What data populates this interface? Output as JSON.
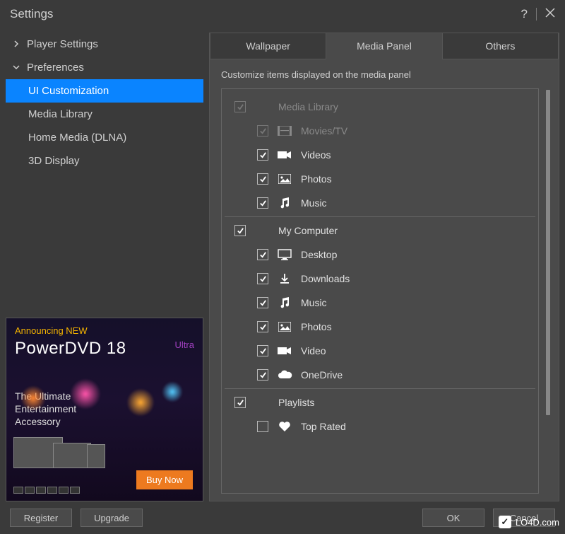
{
  "title": "Settings",
  "sidebar": {
    "groups": [
      {
        "label": "Player Settings",
        "expanded": false
      },
      {
        "label": "Preferences",
        "expanded": true
      }
    ],
    "items": [
      {
        "label": "UI Customization",
        "selected": true
      },
      {
        "label": "Media Library"
      },
      {
        "label": "Home Media (DLNA)"
      },
      {
        "label": "3D Display"
      }
    ]
  },
  "ad": {
    "announcing": "Announcing NEW",
    "ultra": "Ultra",
    "product": "PowerDVD 18",
    "tagline": "The Ultimate Entertainment Accessory",
    "buy": "Buy Now"
  },
  "tabs": [
    {
      "label": "Wallpaper"
    },
    {
      "label": "Media Panel",
      "active": true
    },
    {
      "label": "Others"
    }
  ],
  "panel": {
    "desc": "Customize items displayed on the media panel"
  },
  "tree": {
    "media_library": {
      "label": "Media Library",
      "checked": true,
      "disabled": true
    },
    "movies_tv": {
      "label": "Movies/TV",
      "checked": true,
      "disabled": true
    },
    "videos": {
      "label": "Videos",
      "checked": true
    },
    "photos": {
      "label": "Photos",
      "checked": true
    },
    "music": {
      "label": "Music",
      "checked": true
    },
    "my_computer": {
      "label": "My Computer",
      "checked": true
    },
    "desktop": {
      "label": "Desktop",
      "checked": true
    },
    "downloads": {
      "label": "Downloads",
      "checked": true
    },
    "mc_music": {
      "label": "Music",
      "checked": true
    },
    "mc_photos": {
      "label": "Photos",
      "checked": true
    },
    "mc_video": {
      "label": "Video",
      "checked": true
    },
    "onedrive": {
      "label": "OneDrive",
      "checked": true
    },
    "playlists": {
      "label": "Playlists",
      "checked": true
    },
    "top_rated": {
      "label": "Top Rated",
      "checked": false
    }
  },
  "footer": {
    "register": "Register",
    "upgrade": "Upgrade",
    "ok": "OK",
    "cancel": "Cancel"
  },
  "watermark": "LO4D.com"
}
